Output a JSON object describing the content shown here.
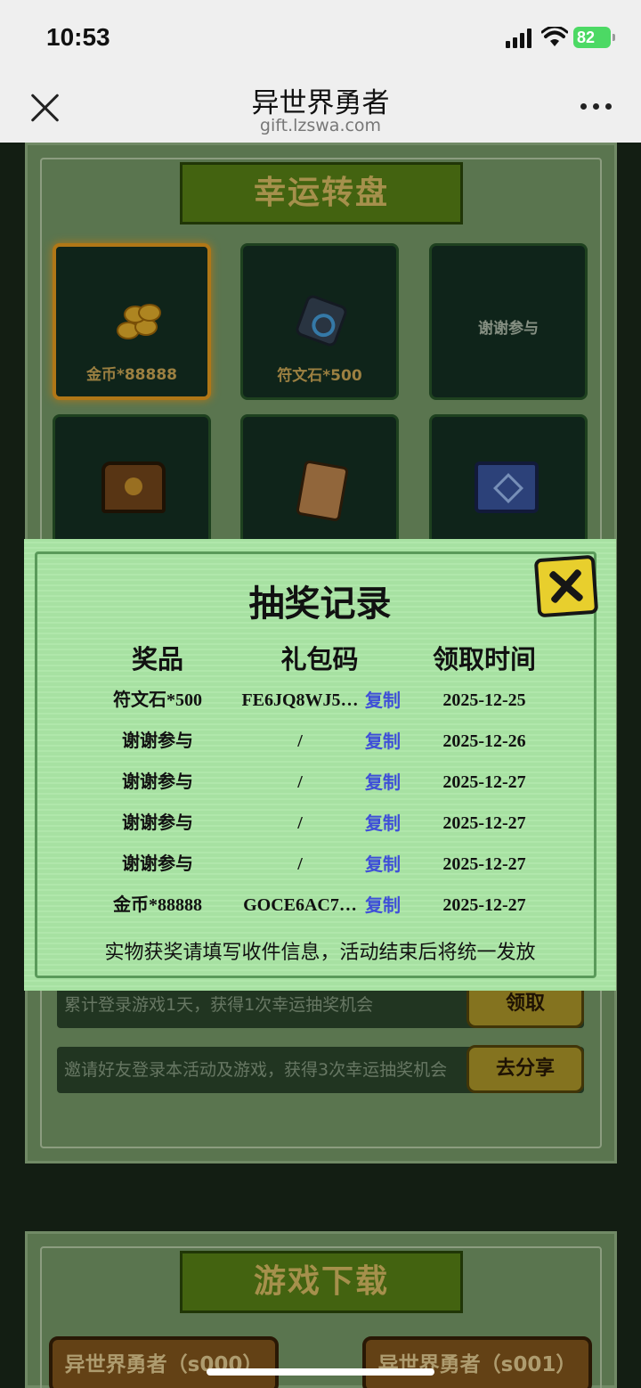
{
  "status_bar": {
    "time": "10:53",
    "battery": "82"
  },
  "navbar": {
    "title": "异世界勇者",
    "subtitle": "gift.lzswa.com"
  },
  "lucky_wheel": {
    "title": "幸运转盘",
    "prizes": [
      {
        "label": "金币*88888",
        "icon": "gold-coins-icon",
        "selected": true
      },
      {
        "label": "符文石*500",
        "icon": "rune-stone-icon"
      },
      {
        "label": "谢谢参与"
      },
      {
        "icon": "treasure-chest-icon"
      },
      {
        "icon": "scroll-icon"
      },
      {
        "icon": "blue-chest-icon"
      }
    ]
  },
  "tasks": [
    {
      "text": "累计登录游戏1天，获得1次幸运抽奖机会",
      "button": "领取"
    },
    {
      "text": "邀请好友登录本活动及游戏，获得3次幸运抽奖机会",
      "button": "去分享"
    }
  ],
  "download": {
    "title": "游戏下载",
    "buttons": [
      "异世界勇者（s000）",
      "异世界勇者（s001）"
    ]
  },
  "modal": {
    "title": "抽奖记录",
    "headers": {
      "prize": "奖品",
      "code": "礼包码",
      "time": "领取时间"
    },
    "records": [
      {
        "prize": "符文石*500",
        "code": "FE6JQ8WJ5…",
        "copy": "复制",
        "time": "2025-12-25"
      },
      {
        "prize": "谢谢参与",
        "code": "/",
        "copy": "复制",
        "time": "2025-12-26"
      },
      {
        "prize": "谢谢参与",
        "code": "/",
        "copy": "复制",
        "time": "2025-12-27"
      },
      {
        "prize": "谢谢参与",
        "code": "/",
        "copy": "复制",
        "time": "2025-12-27"
      },
      {
        "prize": "谢谢参与",
        "code": "/",
        "copy": "复制",
        "time": "2025-12-27"
      },
      {
        "prize": "金币*88888",
        "code": "GOCE6AC7…",
        "copy": "复制",
        "time": "2025-12-27"
      }
    ],
    "note": "实物获奖请填写收件信息，活动结束后将统一发放"
  },
  "colors": {
    "accent_gold": "#e7c86a",
    "link_blue": "#3f4fd8",
    "modal_green": "#a7e1a2",
    "close_yellow": "#e8cf2d"
  }
}
